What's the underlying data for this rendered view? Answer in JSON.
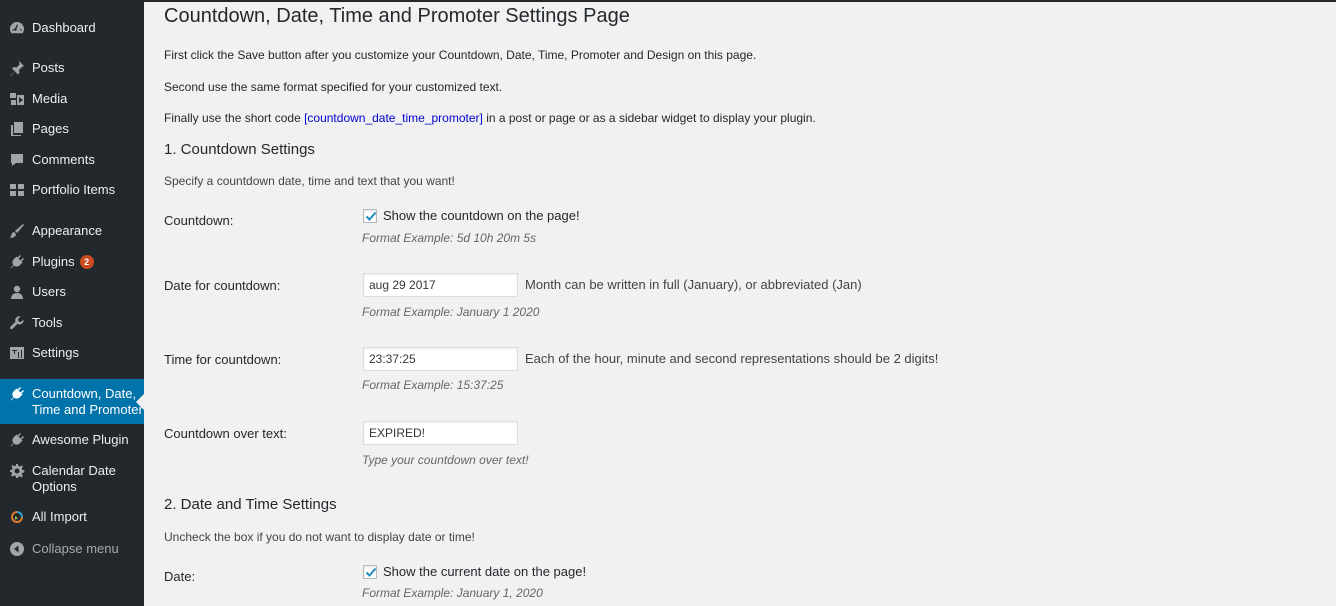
{
  "sidebar": {
    "items": [
      {
        "label": "Dashboard",
        "icon": "dashboard-icon"
      },
      {
        "label": "Posts",
        "icon": "pin-icon"
      },
      {
        "label": "Media",
        "icon": "media-icon"
      },
      {
        "label": "Pages",
        "icon": "pages-icon"
      },
      {
        "label": "Comments",
        "icon": "comment-icon"
      },
      {
        "label": "Portfolio Items",
        "icon": "grid-icon"
      },
      {
        "label": "Appearance",
        "icon": "brush-icon"
      },
      {
        "label": "Plugins",
        "icon": "plugin-icon",
        "badge": "2"
      },
      {
        "label": "Users",
        "icon": "user-icon"
      },
      {
        "label": "Tools",
        "icon": "wrench-icon"
      },
      {
        "label": "Settings",
        "icon": "settings-icon"
      },
      {
        "label": "Countdown, Date,",
        "label2": "Time and Promoter",
        "icon": "plugin-icon",
        "current": true
      },
      {
        "label": "Awesome Plugin",
        "icon": "plugin-icon"
      },
      {
        "label": "Calendar Date",
        "label2": "Options",
        "icon": "gear-icon"
      },
      {
        "label": "All Import",
        "icon": "import-icon"
      },
      {
        "label": "Collapse menu",
        "icon": "collapse-icon"
      }
    ]
  },
  "page": {
    "title": "Countdown, Date, Time and Promoter Settings Page",
    "intro1": "First click the Save button after you customize your Countdown, Date, Time, Promoter and Design on this page.",
    "intro2": "Second use the same format specified for your customized text.",
    "intro3_before": "Finally use the short code ",
    "intro3_code": "[countdown_date_time_promoter]",
    "intro3_after": " in a post or page or as a sidebar widget to display your plugin."
  },
  "countdown_section": {
    "heading": "1. Countdown Settings",
    "desc": "Specify a countdown date, time and text that you want!",
    "countdown_label": "Countdown:",
    "countdown_checkbox_label": "Show the countdown on the page!",
    "countdown_checked": true,
    "countdown_example": "Format Example: 5d 10h 20m 5s",
    "date_label": "Date for countdown:",
    "date_value": "aug 29 2017",
    "date_hint": "Month can be written in full (January), or abbreviated (Jan)",
    "date_example": "Format Example: January 1 2020",
    "time_label": "Time for countdown:",
    "time_value": "23:37:25",
    "time_hint": "Each of the hour, minute and second representations should be 2 digits!",
    "time_example": "Format Example: 15:37:25",
    "over_label": "Countdown over text:",
    "over_value": "EXPIRED!",
    "over_example": "Type your countdown over text!"
  },
  "datetime_section": {
    "heading": "2. Date and Time Settings",
    "desc": "Uncheck the box if you do not want to display date or time!",
    "date_label": "Date:",
    "date_checkbox_label": "Show the current date on the page!",
    "date_checked": true,
    "date_example": "Format Example: January 1, 2020"
  },
  "colors": {
    "sidebar_bg": "#23282d",
    "current_bg": "#0073aa",
    "badge": "#ca4a1f",
    "link": "#0000cc"
  }
}
